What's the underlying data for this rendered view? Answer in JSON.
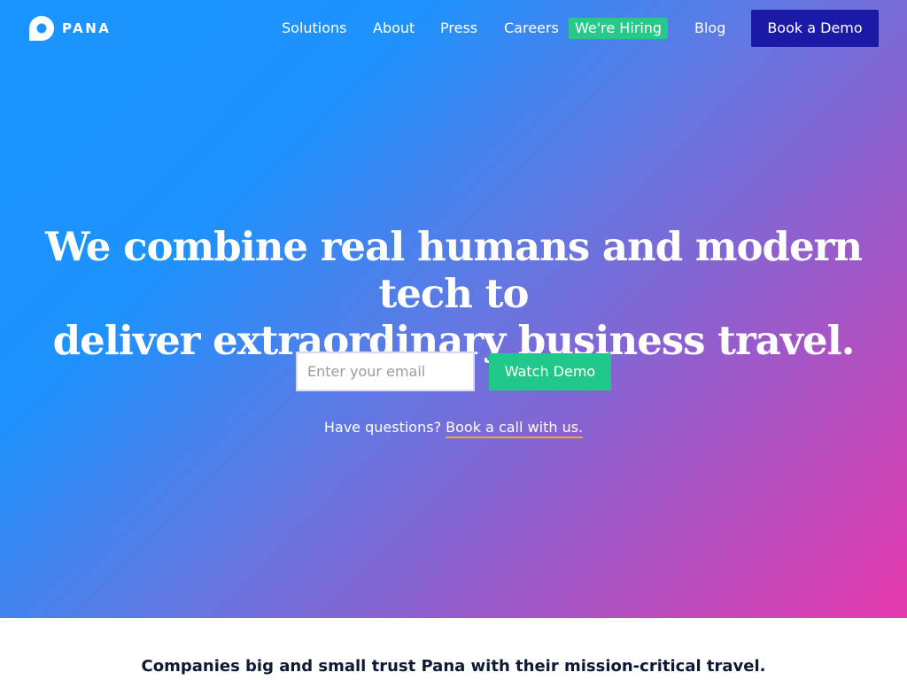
{
  "brand": {
    "name": "PANA"
  },
  "nav": {
    "items": [
      {
        "label": "Solutions"
      },
      {
        "label": "About"
      },
      {
        "label": "Press"
      },
      {
        "label": "Careers"
      },
      {
        "label": "Blog"
      }
    ],
    "hiring_badge": "We're Hiring",
    "cta": "Book a Demo"
  },
  "hero": {
    "headline_line1": "We combine real humans and modern tech to",
    "headline_line2": "deliver extraordinary business travel.",
    "email_placeholder": "Enter your email",
    "email_value": "",
    "watch_button": "Watch Demo",
    "questions_prefix": "Have questions?",
    "call_link": "Book a call with us."
  },
  "trust": {
    "text": "Companies big and small trust Pana with their mission-critical travel."
  },
  "colors": {
    "gradient_start": "#1a95ff",
    "gradient_end": "#e83aae",
    "hiring_green": "#27c98a",
    "cta_navy": "#1a1aa6",
    "watch_green": "#20c98a",
    "link_underline": "#f5a623",
    "trust_text": "#0c1a33"
  },
  "icons": {
    "logo": "pana-logo-icon"
  }
}
